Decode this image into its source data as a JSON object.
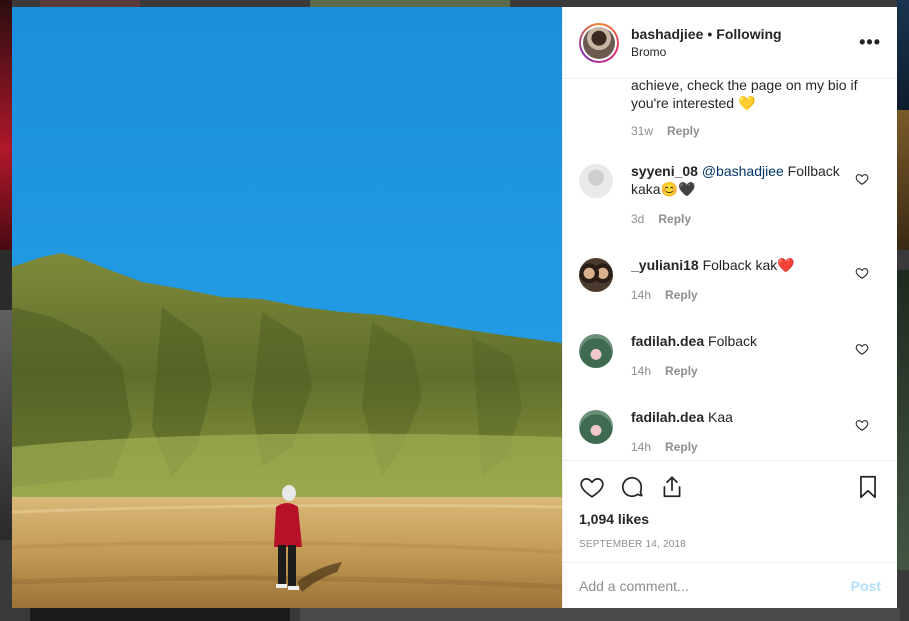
{
  "post": {
    "username": "bashadjiee",
    "follow_status": "Following",
    "location": "Bromo",
    "caption_tail": "achieve, check the page on my bio if you're interested 💛",
    "caption_time": "31w",
    "likes": "1,094 likes",
    "date": "SEPTEMBER 14, 2018"
  },
  "labels": {
    "reply": "Reply",
    "more": "•••",
    "separator": "•",
    "add_comment_placeholder": "Add a comment...",
    "post_button": "Post"
  },
  "comments": [
    {
      "user": "syyeni_08",
      "mention": "@bashadjiee",
      "text": " Follback kaka😊🖤",
      "time": "3d"
    },
    {
      "user": "_yuliani18",
      "mention": "",
      "text": " Folback kak❤️",
      "time": "14h"
    },
    {
      "user": "fadilah.dea",
      "mention": "",
      "text": " Folback",
      "time": "14h"
    },
    {
      "user": "fadilah.dea",
      "mention": "",
      "text": " Kaa",
      "time": "14h"
    }
  ],
  "colors": {
    "sky": "#1e96e0",
    "hill": "#6f7f35",
    "grass": "#c7a25e",
    "jacket": "#b5122a",
    "post_disabled": "#b2dffc",
    "mention": "#003569"
  },
  "icons": [
    "more-options-icon",
    "heart-icon",
    "comment-icon",
    "share-icon",
    "bookmark-icon"
  ]
}
